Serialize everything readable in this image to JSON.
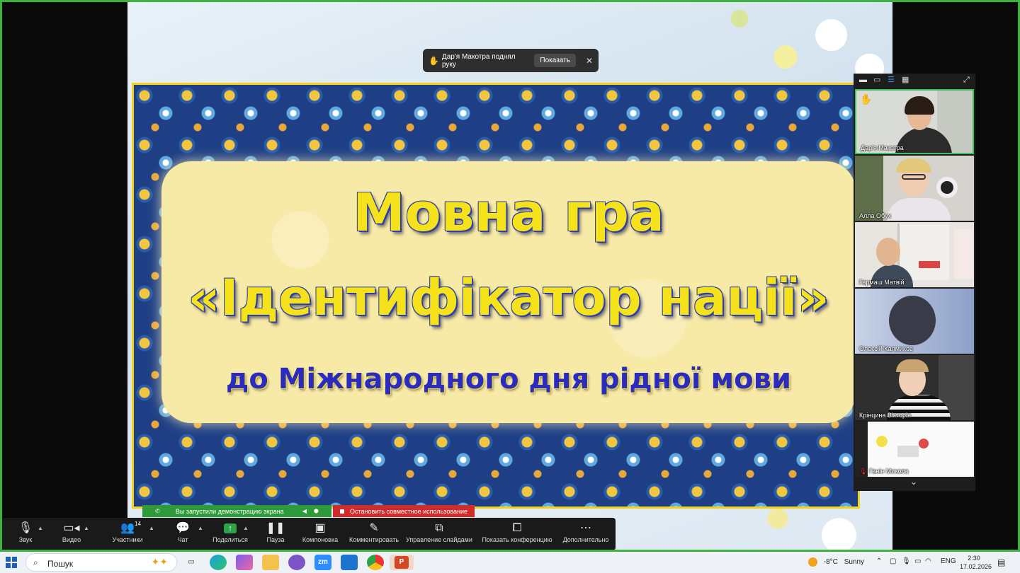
{
  "notification": {
    "raised_hand_text": "Дар'я Макотра поднял руку",
    "show_label": "Показать",
    "close_symbol": "✕"
  },
  "slide": {
    "title_line1": "Мовна гра",
    "title_line2": "«Ідентифікатор нації»",
    "subtitle": "до Міжнародного дня рідної мови"
  },
  "gallery": {
    "participants": [
      {
        "name": "Дар'я Макотра",
        "hand_raised": true,
        "active": true
      },
      {
        "name": "Алла Обух"
      },
      {
        "name": "Гармаш Матвій"
      },
      {
        "name": "Олексій Калмиков"
      },
      {
        "name": "Крінцина Вікторія"
      },
      {
        "name": "Ганін Микола",
        "muted": true
      }
    ]
  },
  "share_bar": {
    "status": "Вы запустили демонстрацию экрана",
    "stop_label": "Остановить совместное использование"
  },
  "toolbar": {
    "participant_count": "14",
    "items": [
      {
        "label": "Звук",
        "icon": "microphone-icon"
      },
      {
        "label": "Видео",
        "icon": "video-camera-icon"
      },
      {
        "label": "Участники",
        "icon": "participants-icon"
      },
      {
        "label": "Чат",
        "icon": "chat-icon"
      },
      {
        "label": "Поделиться",
        "icon": "share-screen-icon"
      },
      {
        "label": "Пауза",
        "icon": "pause-icon"
      },
      {
        "label": "Компоновка",
        "icon": "layout-icon"
      },
      {
        "label": "Комментировать",
        "icon": "annotate-pen-icon"
      },
      {
        "label": "Управление слайдами",
        "icon": "slide-control-icon"
      },
      {
        "label": "Показать конференцию",
        "icon": "show-meeting-icon"
      },
      {
        "label": "Дополнительно",
        "icon": "more-icon"
      }
    ]
  },
  "taskbar": {
    "search_label": "Пошук",
    "weather_temp": "-8°C",
    "weather_text": "Sunny",
    "language": "ENG",
    "time": "2:30",
    "date": "17.02.2026"
  },
  "colors": {
    "zoom_green": "#2f9a3a",
    "stop_red": "#d12c2c",
    "title_yellow": "#f6e21a",
    "subtitle_blue": "#2b2cbf"
  }
}
